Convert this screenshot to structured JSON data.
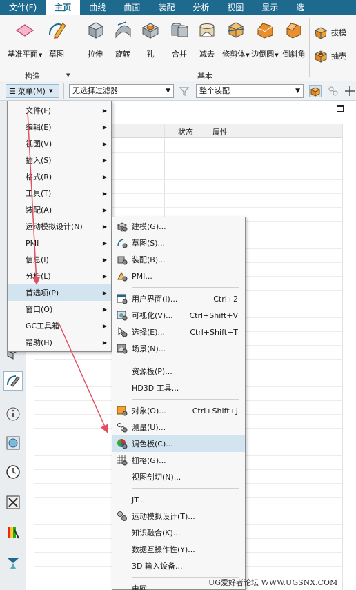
{
  "menubar": {
    "items": [
      {
        "label": "文件(F)",
        "active": false
      },
      {
        "label": "主页",
        "active": true
      },
      {
        "label": "曲线",
        "active": false
      },
      {
        "label": "曲面",
        "active": false
      },
      {
        "label": "装配",
        "active": false
      },
      {
        "label": "分析",
        "active": false
      },
      {
        "label": "视图",
        "active": false
      },
      {
        "label": "显示",
        "active": false
      },
      {
        "label": "选",
        "active": false
      }
    ]
  },
  "ribbon": {
    "construct_group": {
      "label": "构造",
      "buttons": [
        {
          "label": "基准平面",
          "icon": "datum-plane-icon",
          "dropdown": true
        },
        {
          "label": "草图",
          "icon": "sketch-icon",
          "dropdown": false
        }
      ]
    },
    "basic_group": {
      "label": "基本",
      "buttons": [
        {
          "label": "拉伸",
          "icon": "extrude-icon",
          "dropdown": false
        },
        {
          "label": "旋转",
          "icon": "revolve-icon",
          "dropdown": false
        },
        {
          "label": "孔",
          "icon": "hole-icon",
          "dropdown": false
        },
        {
          "label": "合并",
          "icon": "unite-icon",
          "dropdown": false
        },
        {
          "label": "减去",
          "icon": "subtract-icon",
          "dropdown": false
        },
        {
          "label": "修剪体",
          "icon": "trim-body-icon",
          "dropdown": true
        },
        {
          "label": "边倒圆",
          "icon": "edge-blend-icon",
          "dropdown": true
        },
        {
          "label": "倒斜角",
          "icon": "chamfer-icon",
          "dropdown": false
        }
      ]
    },
    "small_buttons": [
      {
        "label": "拔模",
        "icon": "draft-icon"
      },
      {
        "label": "抽壳",
        "icon": "shell-icon"
      }
    ]
  },
  "toolbar": {
    "menu_label": "菜单(M)",
    "filter_value": "无选择过滤器",
    "assembly_value": "整个装配"
  },
  "navigator": {
    "columns": [
      "状态",
      "属性"
    ]
  },
  "main_menu": {
    "items": [
      {
        "label": "文件(F)",
        "has_sub": true,
        "highlighted": false
      },
      {
        "label": "编辑(E)",
        "has_sub": true,
        "highlighted": false
      },
      {
        "label": "视图(V)",
        "has_sub": true,
        "highlighted": false
      },
      {
        "label": "插入(S)",
        "has_sub": true,
        "highlighted": false
      },
      {
        "label": "格式(R)",
        "has_sub": true,
        "highlighted": false
      },
      {
        "label": "工具(T)",
        "has_sub": true,
        "highlighted": false
      },
      {
        "label": "装配(A)",
        "has_sub": true,
        "highlighted": false
      },
      {
        "label": "运动模拟设计(N)",
        "has_sub": true,
        "highlighted": false
      },
      {
        "label": "PMI",
        "has_sub": true,
        "highlighted": false
      },
      {
        "label": "信息(I)",
        "has_sub": true,
        "highlighted": false
      },
      {
        "label": "分析(L)",
        "has_sub": true,
        "highlighted": false
      },
      {
        "label": "首选项(P)",
        "has_sub": true,
        "highlighted": true
      },
      {
        "label": "窗口(O)",
        "has_sub": true,
        "highlighted": false
      },
      {
        "label": "GC工具箱",
        "has_sub": true,
        "highlighted": false
      },
      {
        "label": "帮助(H)",
        "has_sub": true,
        "highlighted": false
      }
    ]
  },
  "pref_menu": {
    "items": [
      {
        "label": "建模(G)...",
        "icon": "modeling-icon",
        "shortcut": "",
        "highlighted": false
      },
      {
        "label": "草图(S)...",
        "icon": "sketch-pref-icon",
        "shortcut": "",
        "highlighted": false
      },
      {
        "label": "装配(B)...",
        "icon": "assembly-pref-icon",
        "shortcut": "",
        "highlighted": false
      },
      {
        "label": "PMI...",
        "icon": "pmi-pref-icon",
        "shortcut": "",
        "highlighted": false
      },
      {
        "sep": true
      },
      {
        "label": "用户界面(I)...",
        "icon": "user-interface-icon",
        "shortcut": "Ctrl+2",
        "highlighted": false
      },
      {
        "label": "可视化(V)...",
        "icon": "visualization-icon",
        "shortcut": "Ctrl+Shift+V",
        "highlighted": false
      },
      {
        "label": "选择(E)...",
        "icon": "selection-icon",
        "shortcut": "Ctrl+Shift+T",
        "highlighted": false
      },
      {
        "label": "场景(N)...",
        "icon": "scene-icon",
        "shortcut": "",
        "highlighted": false
      },
      {
        "sep": true
      },
      {
        "label": "资源板(P)...",
        "icon": "",
        "shortcut": "",
        "highlighted": false
      },
      {
        "label": "HD3D 工具...",
        "icon": "",
        "shortcut": "",
        "highlighted": false
      },
      {
        "sep": true
      },
      {
        "label": "对象(O)...",
        "icon": "object-icon",
        "shortcut": "Ctrl+Shift+J",
        "highlighted": false
      },
      {
        "label": "测量(U)...",
        "icon": "measure-icon",
        "shortcut": "",
        "highlighted": false
      },
      {
        "label": "调色板(C)...",
        "icon": "palette-icon",
        "shortcut": "",
        "highlighted": true
      },
      {
        "label": "栅格(G)...",
        "icon": "grid-icon",
        "shortcut": "",
        "highlighted": false
      },
      {
        "label": "视图剖切(N)...",
        "icon": "",
        "shortcut": "",
        "highlighted": false
      },
      {
        "sep": true
      },
      {
        "label": "JT...",
        "icon": "",
        "shortcut": "",
        "highlighted": false
      },
      {
        "label": "运动模拟设计(T)...",
        "icon": "motion-icon",
        "shortcut": "",
        "highlighted": false
      },
      {
        "label": "知识融合(K)...",
        "icon": "",
        "shortcut": "",
        "highlighted": false
      },
      {
        "label": "数据互操作性(Y)...",
        "icon": "",
        "shortcut": "",
        "highlighted": false
      },
      {
        "label": "3D 输入设备...",
        "icon": "",
        "shortcut": "",
        "highlighted": false
      },
      {
        "sep": true
      },
      {
        "label": "电网...",
        "icon": "",
        "shortcut": "",
        "highlighted": false
      }
    ]
  },
  "resource_bar": {
    "icons": [
      "part-navigator-icon",
      "sketch-resource-icon",
      "info-icon",
      "web-browser-icon",
      "history-clock-icon",
      "process-studio-icon",
      "reuse-library-icon",
      "roles-icon"
    ]
  },
  "watermark": "UG爱好者论坛 WWW.UGSNX.COM",
  "colors": {
    "accent": "#1e6a8f",
    "highlight": "#d2e4ef",
    "annotation_arrow": "#e05060"
  }
}
